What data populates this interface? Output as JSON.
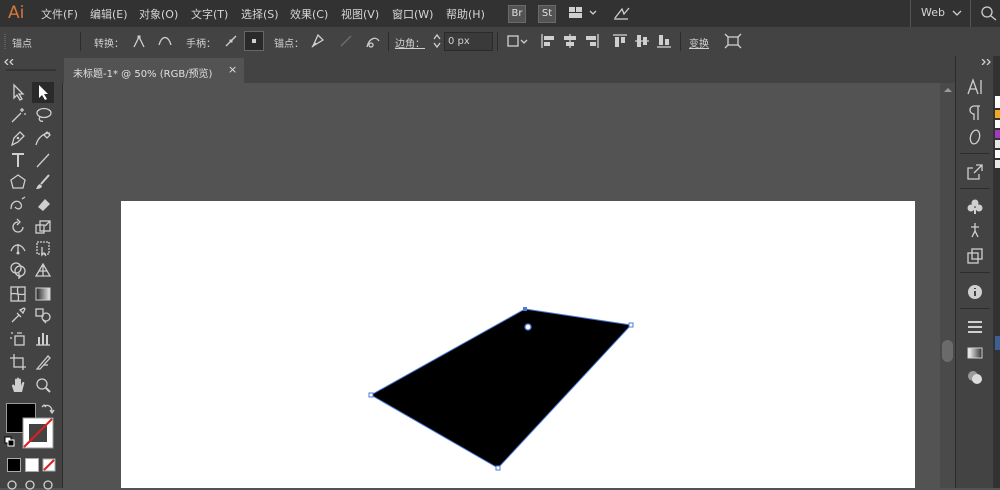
{
  "app": {
    "logo": "Ai"
  },
  "menu": [
    "文件(F)",
    "编辑(E)",
    "对象(O)",
    "文字(T)",
    "选择(S)",
    "效果(C)",
    "视图(V)",
    "窗口(W)",
    "帮助(H)"
  ],
  "topbar": {
    "bridge": "Br",
    "stock": "St",
    "workspace": "Web"
  },
  "control": {
    "anchor_label": "锚点",
    "convert_label": "转换：",
    "handles_label": "手柄：",
    "anchors_label": "锚点：",
    "corner_label": "边角：",
    "corner_value": "0 px",
    "transform_label": "变换"
  },
  "document": {
    "tab_title": "未标题-1* @ 50% (RGB/预览)",
    "close": "×"
  },
  "colors": {
    "fill": "#000000",
    "stroke": "none",
    "accent": "#d4773a",
    "selection": "#4a7bd8"
  }
}
